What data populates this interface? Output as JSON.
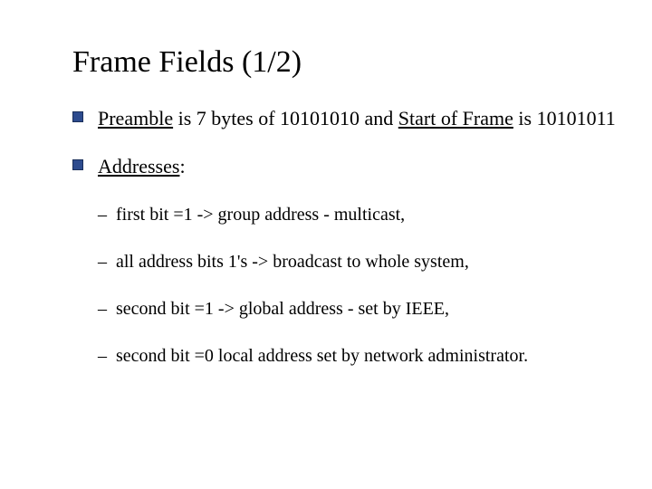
{
  "title": "Frame Fields (1/2)",
  "bullets": [
    {
      "parts": [
        {
          "text": "Preamble",
          "u": true
        },
        {
          "text": " is 7 bytes of 10101010 and "
        },
        {
          "text": "Start of Frame",
          "u": true
        },
        {
          "text": " is 10101011"
        }
      ]
    },
    {
      "parts": [
        {
          "text": "Addresses",
          "u": true
        },
        {
          "text": ":"
        }
      ],
      "subs": [
        "first bit =1 -> group address - multicast,",
        "all address bits 1's -> broadcast to whole system,",
        "second bit =1 -> global address - set by IEEE,",
        "second bit =0 local address set by network administrator."
      ]
    }
  ]
}
